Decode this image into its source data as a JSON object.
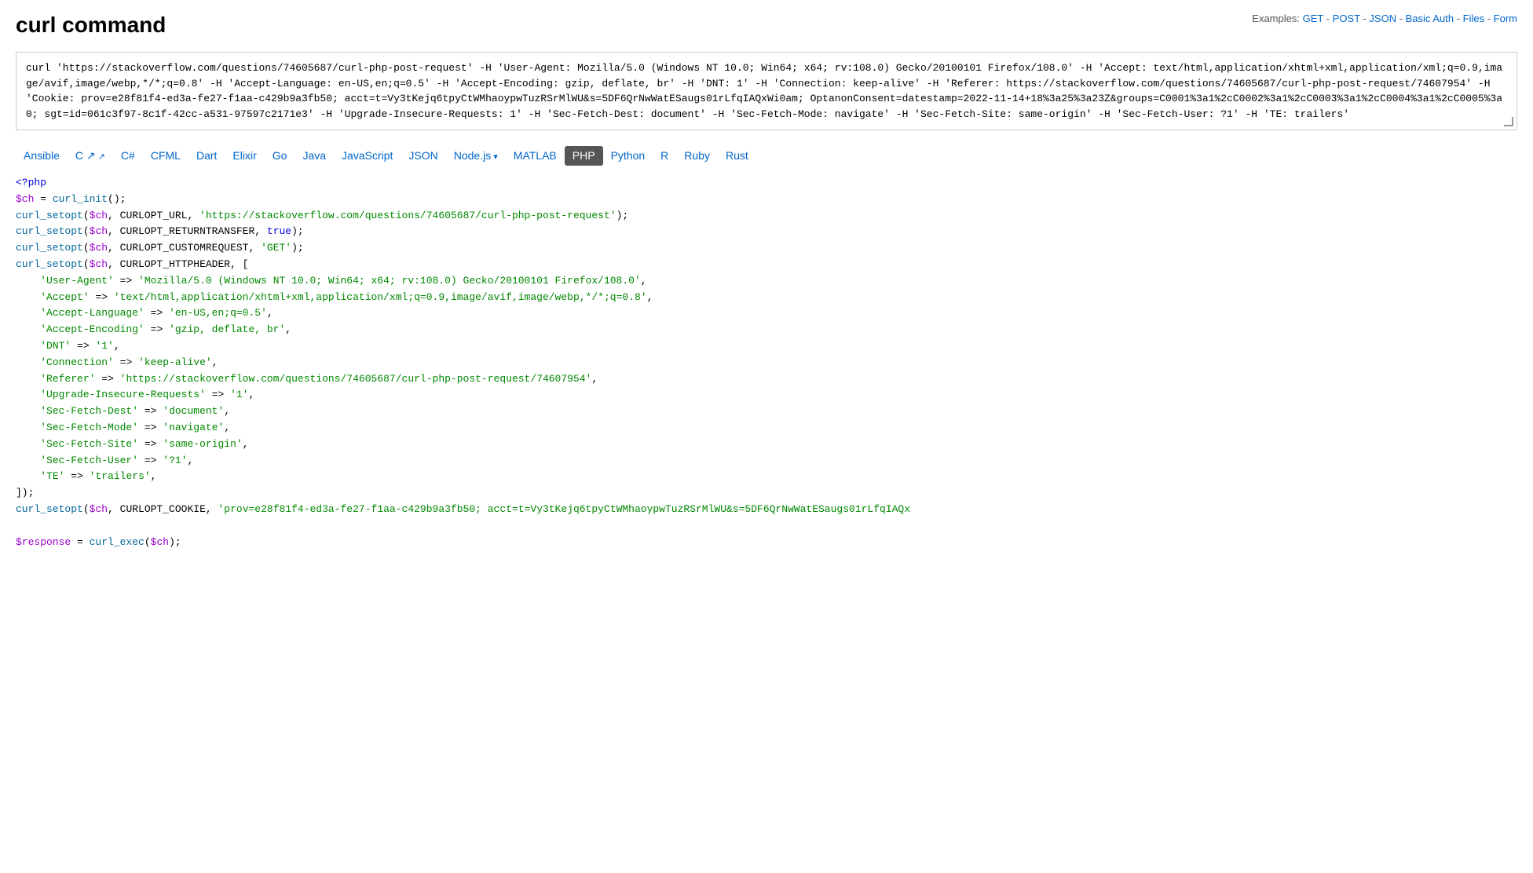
{
  "header": {
    "title": "curl command",
    "examples_label": "Examples:",
    "examples_links": [
      {
        "text": "GET",
        "href": "#"
      },
      {
        "text": "POST",
        "href": "#"
      },
      {
        "text": "JSON",
        "href": "#"
      },
      {
        "text": "Basic Auth",
        "href": "#"
      },
      {
        "text": "Files",
        "href": "#"
      },
      {
        "text": "Form",
        "href": "#"
      }
    ]
  },
  "curl_command": "curl 'https://stackoverflow.com/questions/74605687/curl-php-post-request' -H 'User-Agent: Mozilla/5.0 (Windows NT 10.0; Win64; x64; rv:108.0) Gecko/20100101 Firefox/108.0' -H 'Accept: text/html,application/xhtml+xml,application/xml;q=0.9,image/avif,image/webp,*/*;q=0.8' -H 'Accept-Language: en-US,en;q=0.5' -H 'Accept-Encoding: gzip, deflate, br' -H 'DNT: 1' -H 'Connection: keep-alive' -H 'Referer: https://stackoverflow.com/questions/74605687/curl-php-post-request/74607954' -H 'Cookie: prov=e28f81f4-ed3a-fe27-f1aa-c429b9a3fb50; acct=t=Vy3tKejq6tpyCtWMhaoypwTuzRSrMlWU&s=5DF6QrNwWatESaugs01rLfqIAQxWi0am; OptanonConsent=datestamp=2022-11-14+18%3a25%3a23Z&groups=C0001%3a1%2cC0002%3a1%2cC0003%3a1%2cC0004%3a1%2cC0005%3a0; sgt=id=061c3f97-8c1f-42cc-a531-97597c2171e3' -H 'Upgrade-Insecure-Requests: 1' -H 'Sec-Fetch-Dest: document' -H 'Sec-Fetch-Mode: navigate' -H 'Sec-Fetch-Site: same-origin' -H 'Sec-Fetch-User: ?1' -H 'TE: trailers'",
  "language_tabs": [
    {
      "label": "Ansible",
      "active": false,
      "external": false,
      "dropdown": false
    },
    {
      "label": "C",
      "active": false,
      "external": true,
      "dropdown": false
    },
    {
      "label": "C#",
      "active": false,
      "external": false,
      "dropdown": false
    },
    {
      "label": "CFML",
      "active": false,
      "external": false,
      "dropdown": false
    },
    {
      "label": "Dart",
      "active": false,
      "external": false,
      "dropdown": false
    },
    {
      "label": "Elixir",
      "active": false,
      "external": false,
      "dropdown": false
    },
    {
      "label": "Go",
      "active": false,
      "external": false,
      "dropdown": false
    },
    {
      "label": "Java",
      "active": false,
      "external": false,
      "dropdown": false
    },
    {
      "label": "JavaScript",
      "active": false,
      "external": false,
      "dropdown": false
    },
    {
      "label": "JSON",
      "active": false,
      "external": false,
      "dropdown": false
    },
    {
      "label": "Node.js",
      "active": false,
      "external": false,
      "dropdown": true
    },
    {
      "label": "MATLAB",
      "active": false,
      "external": false,
      "dropdown": false
    },
    {
      "label": "PHP",
      "active": true,
      "external": false,
      "dropdown": false
    },
    {
      "label": "Python",
      "active": false,
      "external": false,
      "dropdown": false
    },
    {
      "label": "R",
      "active": false,
      "external": false,
      "dropdown": false
    },
    {
      "label": "Ruby",
      "active": false,
      "external": false,
      "dropdown": false
    },
    {
      "label": "Rust",
      "active": false,
      "external": false,
      "dropdown": false
    }
  ],
  "php_code": {
    "lines": [
      "<?php",
      "$ch = curl_init();",
      "curl_setopt($ch, CURLOPT_URL, 'https://stackoverflow.com/questions/74605687/curl-php-post-request');",
      "curl_setopt($ch, CURLOPT_RETURNTRANSFER, true);",
      "curl_setopt($ch, CURLOPT_CUSTOMREQUEST, 'GET');",
      "curl_setopt($ch, CURLOPT_HTTPHEADER, [",
      "    'User-Agent' => 'Mozilla/5.0 (Windows NT 10.0; Win64; x64; rv:108.0) Gecko/20100101 Firefox/108.0',",
      "    'Accept' => 'text/html,application/xhtml+xml,application/xml;q=0.9,image/avif,image/webp,*/*;q=0.8',",
      "    'Accept-Language' => 'en-US,en;q=0.5',",
      "    'Accept-Encoding' => 'gzip, deflate, br',",
      "    'DNT' => '1',",
      "    'Connection' => 'keep-alive',",
      "    'Referer' => 'https://stackoverflow.com/questions/74605687/curl-php-post-request/74607954',",
      "    'Upgrade-Insecure-Requests' => '1',",
      "    'Sec-Fetch-Dest' => 'document',",
      "    'Sec-Fetch-Mode' => 'navigate',",
      "    'Sec-Fetch-Site' => 'same-origin',",
      "    'Sec-Fetch-User' => '?1',",
      "    'TE' => 'trailers',",
      "]);",
      "curl_setopt($ch, CURLOPT_COOKIE, 'prov=e28f81f4-ed3a-fe27-f1aa-c429b9a3fb50; acct=t=Vy3tKejq6tpyCtWMhaoypwTuzRSrMlWU&s=5DF6QrNwWatESaugs01rLfqIAQx",
      "",
      "$response = curl_exec($ch);"
    ]
  }
}
